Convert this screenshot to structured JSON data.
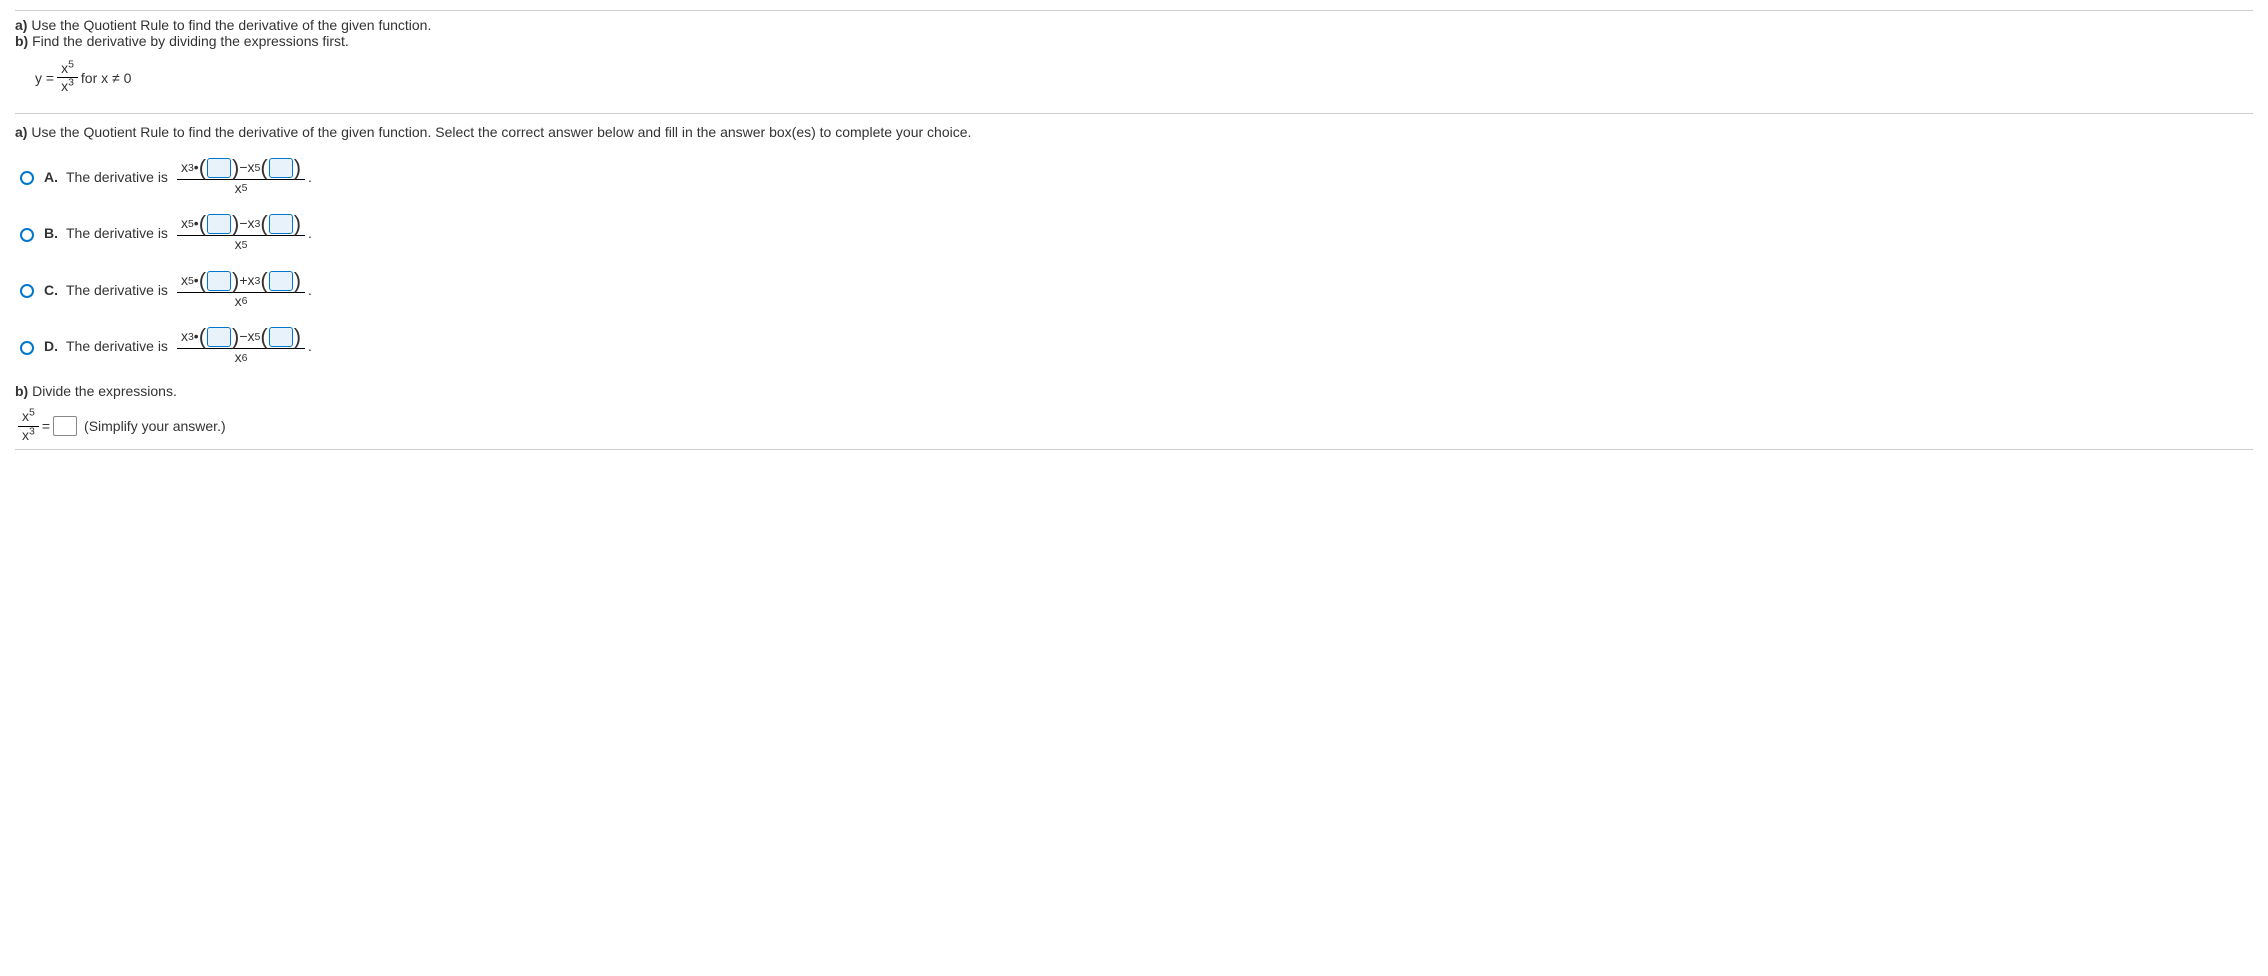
{
  "intro": {
    "a_bold": "a)",
    "a_text": " Use the Quotient Rule to find the derivative of the given function.",
    "b_bold": "b)",
    "b_text": " Find the derivative by dividing the expressions first.",
    "eq_y": "y =",
    "eq_num_base": "x",
    "eq_num_exp": "5",
    "eq_den_base": "x",
    "eq_den_exp": "3",
    "eq_for": " for x ≠ 0"
  },
  "partA": {
    "prompt_bold": "a)",
    "prompt_text": " Use the Quotient Rule to find the derivative of the given function. Select the correct answer below and fill in the answer box(es) to complete your choice."
  },
  "choices": {
    "A": {
      "letter": "A.",
      "text": "The derivative is",
      "t1_base": "x",
      "t1_exp": "3",
      "op": " − ",
      "t2_base": "x",
      "t2_exp": "5",
      "den_base": "x",
      "den_exp": "5"
    },
    "B": {
      "letter": "B.",
      "text": "The derivative is",
      "t1_base": "x",
      "t1_exp": "5",
      "op": " − ",
      "t2_base": "x",
      "t2_exp": "3",
      "den_base": "x",
      "den_exp": "5"
    },
    "C": {
      "letter": "C.",
      "text": "The derivative is",
      "t1_base": "x",
      "t1_exp": "5",
      "op": " + ",
      "t2_base": "x",
      "t2_exp": "3",
      "den_base": "x",
      "den_exp": "6"
    },
    "D": {
      "letter": "D.",
      "text": "The derivative is",
      "t1_base": "x",
      "t1_exp": "3",
      "op": " − ",
      "t2_base": "x",
      "t2_exp": "5",
      "den_base": "x",
      "den_exp": "6"
    }
  },
  "partB": {
    "prompt_bold": "b)",
    "prompt_text": " Divide the expressions.",
    "num_base": "x",
    "num_exp": "5",
    "den_base": "x",
    "den_exp": "3",
    "equals": " = ",
    "hint": "(Simplify your answer.)"
  },
  "sym": {
    "dot": " • ",
    "lparen": "(",
    "rparen": ")",
    "period": "."
  }
}
